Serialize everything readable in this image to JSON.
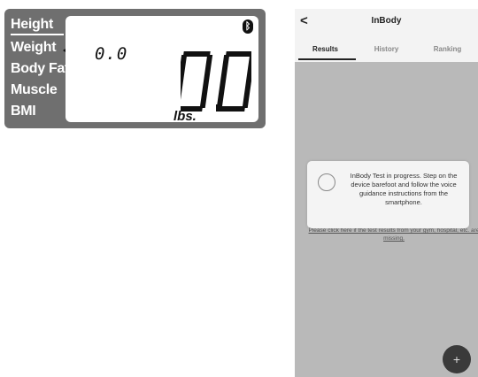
{
  "device": {
    "menu": [
      "Height",
      "Weight",
      "Body Fat",
      "Muscle",
      "BMI"
    ],
    "selected_item": "Weight",
    "small_reading": "0.0",
    "big_reading": "0.0",
    "unit": "lbs.",
    "bluetooth_icon": "bluetooth-icon"
  },
  "app": {
    "back_label": "<",
    "title": "InBody",
    "tabs": [
      "Results",
      "History",
      "Ranking"
    ],
    "active_tab": "Results",
    "dialog": {
      "text": "InBody Test in progress. Step on the device barefoot and follow the voice guidance instructions from the smartphone."
    },
    "missing_link": "Please click here if the test results from your gym, hospital, etc. are missing.",
    "fab_label": "+"
  }
}
